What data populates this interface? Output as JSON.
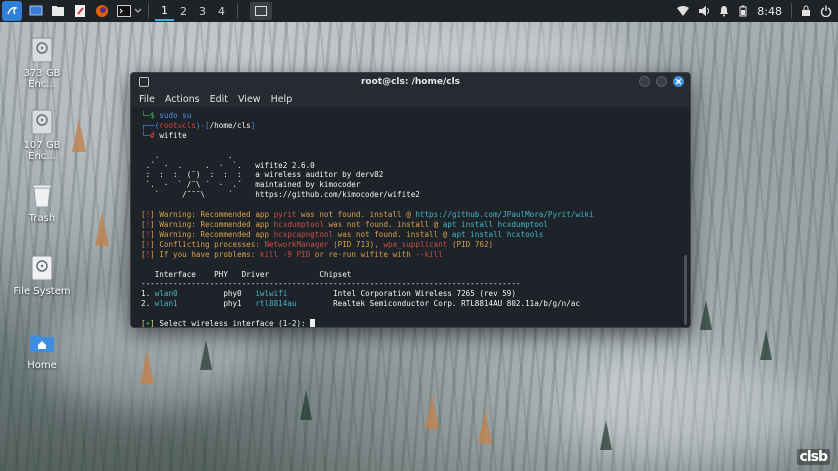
{
  "taskbar": {
    "workspaces": [
      "1",
      "2",
      "3",
      "4"
    ],
    "active_workspace": "1",
    "clock": "8:48"
  },
  "desktop": {
    "icons": [
      {
        "label": "373 GB Enc...",
        "icon": "drive-icon"
      },
      {
        "label": "107 GB Enc...",
        "icon": "drive-icon"
      },
      {
        "label": "Trash",
        "icon": "trash-icon"
      },
      {
        "label": "File System",
        "icon": "drive-icon"
      },
      {
        "label": "Home",
        "icon": "home-folder-icon"
      }
    ]
  },
  "terminal": {
    "title": "root@cls: /home/cls",
    "menu": [
      "File",
      "Actions",
      "Edit",
      "View",
      "Help"
    ],
    "lines": {
      "sudo_cmd": "sudo su",
      "prompt_root": "root",
      "prompt_host": "cls",
      "prompt_path": "/home/cls",
      "wifite_cmd": "wifite",
      "banner": [
        "   .               .",
        " .´  ·  .     .  ·  `.   wifite2 2.6.0",
        " :  :  :  (¯)  :  :  :   a wireless auditor by derv82",
        " `.  ·  ` /¯\\ ´  ·  .´   maintained by kimocoder",
        "   `     /¯¯¯\\     ´     https://github.com/kimocoder/wifite2"
      ],
      "warn1_pre": "Warning: Recommended app ",
      "warn1_app": "pyrit",
      "warn1_post": " was not found. install @ ",
      "warn1_link": "https://github.com/JPaulMora/Pyrit/wiki",
      "warn2_app": "hcxdumptool",
      "warn2_cmd": "apt install hcxdumptool",
      "warn3_app": "hcxpcapngtool",
      "warn3_cmd": "apt install hcxtools",
      "conflict_pre": "Conflicting processes: ",
      "conflict_p1": "NetworkManager",
      "conflict_pid1": "(PID 713)",
      "conflict_p2": "wpa_supplicant",
      "conflict_pid2": "(PID 762)",
      "problem_pre": "If you have problems: ",
      "problem_kill": "kill -9 PID",
      "problem_mid": " or re-run wifite with ",
      "problem_flag": "--kill",
      "select_prompt": "Select wireless interface (1-2): "
    },
    "table": {
      "headers": [
        "Interface",
        "PHY",
        "Driver",
        "Chipset"
      ],
      "rows": [
        {
          "num": "1.",
          "iface": "wlan0",
          "phy": "phy0",
          "driver": "iwlwifi",
          "chipset": "Intel Corporation Wireless 7265 (rev 59)"
        },
        {
          "num": "2.",
          "iface": "wlan1",
          "phy": "phy1",
          "driver": "rtl8814au",
          "chipset": "Realtek Semiconductor Corp. RTL8814AU 802.11a/b/g/n/ac"
        }
      ]
    }
  },
  "watermark": "clsb"
}
